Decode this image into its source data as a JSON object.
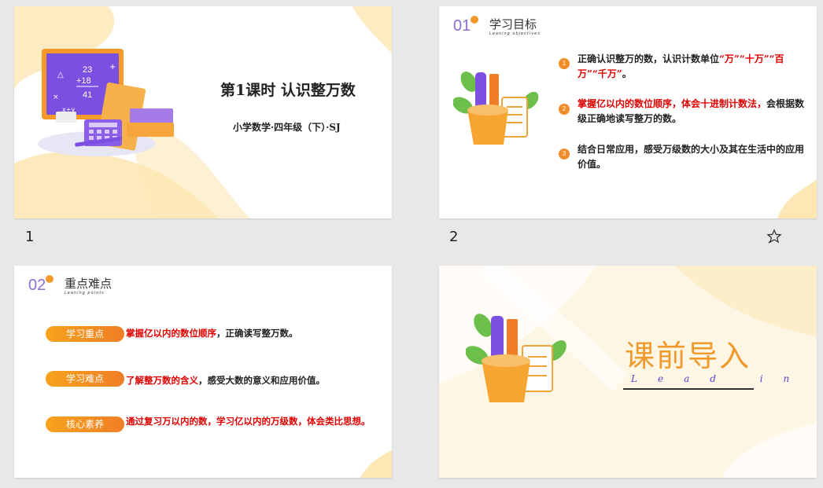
{
  "slides": {
    "s1": {
      "title": "第1课时 认识整万数",
      "subtitle": "小学数学·四年级（下）·SJ",
      "board_lines": [
        "23",
        "+18",
        "41"
      ],
      "board_symbols": [
        "△",
        "+",
        "×",
        "x+y",
        "=",
        "÷"
      ]
    },
    "s2": {
      "num": "01",
      "title": "学习目标",
      "sub": "Leaning objectives",
      "items": [
        {
          "n": "1",
          "parts": [
            "正确认识整万的数，认识计数单位",
            "“万”“十万”“百万”“千万”",
            "。"
          ]
        },
        {
          "n": "2",
          "parts": [
            "掌握亿以内的数位顺序，体会十进制计数法，",
            "会根据数级正确地读写整万的数。"
          ]
        },
        {
          "n": "3",
          "parts": [
            "结合日常应用，感受万级数的大小及其在生活中的应用价值。"
          ]
        }
      ]
    },
    "s3": {
      "num": "02",
      "title": "重点难点",
      "sub": "Leaning points",
      "rows": [
        {
          "label": "学习重点",
          "red": "掌握亿以内的数位顺序",
          "black": "，正确读写整万数。"
        },
        {
          "label": "学习难点",
          "red": "了解整万数的含义",
          "black": "，感受大数的意义和应用价值。"
        },
        {
          "label": "核心素养",
          "red": "通过复习万以内的数，学习亿以内的万级数，体会类比思想。",
          "black": ""
        }
      ]
    },
    "s4": {
      "title": "课前导入",
      "lead": "Lead in"
    }
  },
  "slide_numbers": [
    "1",
    "2"
  ],
  "colors": {
    "accent": "#f28c28",
    "purple": "#8b6fd9",
    "red": "#e00000",
    "cream": "#fde7b5"
  }
}
